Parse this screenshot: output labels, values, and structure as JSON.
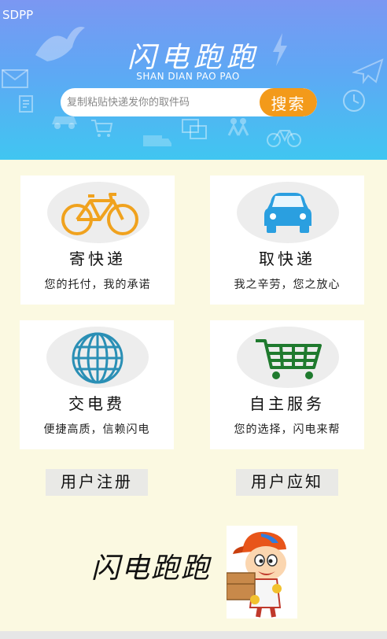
{
  "status_bar": {
    "label": "SDPP"
  },
  "header": {
    "title": "闪电跑跑",
    "subtitle": "SHAN DIAN PAO PAO",
    "gradient": [
      "#7b97f2",
      "#40c6f1"
    ]
  },
  "search": {
    "placeholder": "复制粘贴快递发你的取件码",
    "value": "",
    "button_label": "搜索",
    "button_color": "#f39a1a"
  },
  "cards": [
    {
      "title": "寄快递",
      "subtitle": "您的托付，我的承诺",
      "icon": "bicycle-icon",
      "icon_color": "#f0a21e"
    },
    {
      "title": "取快递",
      "subtitle": "我之辛劳，您之放心",
      "icon": "car-icon",
      "icon_color": "#2a9fe0"
    },
    {
      "title": "交电费",
      "subtitle": "便捷高质，信赖闪电",
      "icon": "globe-icon",
      "icon_color": "#2a8fb5"
    },
    {
      "title": "自主服务",
      "subtitle": "您的选择，闪电来帮",
      "icon": "shopping-cart-icon",
      "icon_color": "#1f7a2e"
    }
  ],
  "links": {
    "register": "用户注册",
    "notice": "用户应知"
  },
  "footer": {
    "brand": "闪电跑跑",
    "mascot": "delivery-boy-mascot"
  }
}
